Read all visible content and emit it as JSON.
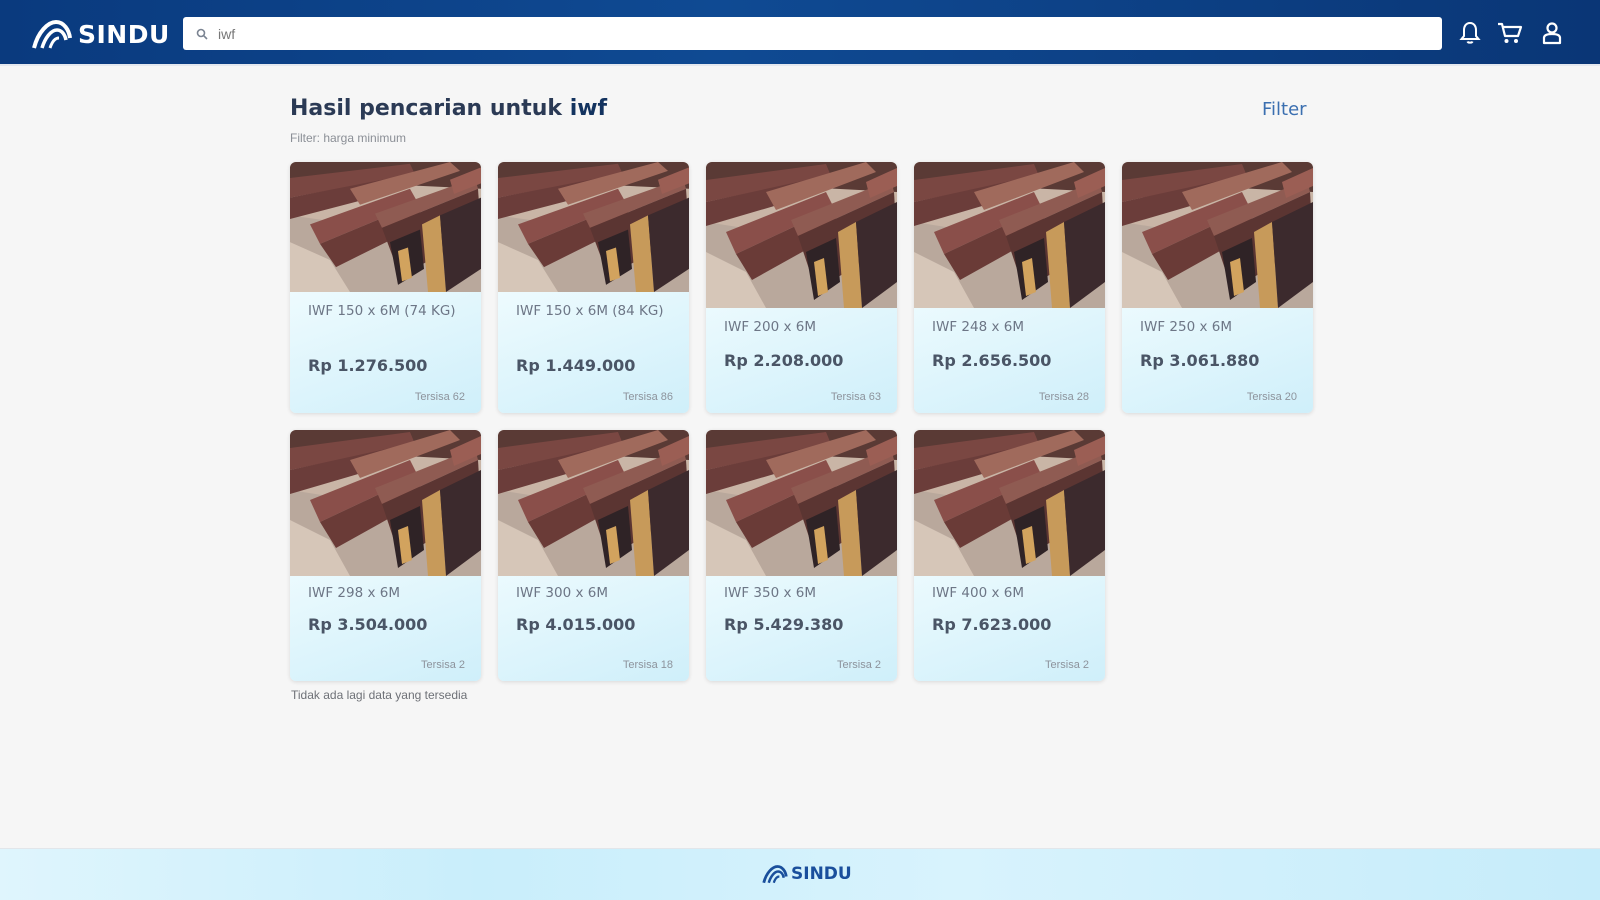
{
  "brand": {
    "name": "SINDU"
  },
  "search": {
    "value": "iwf",
    "icon": "search-icon"
  },
  "nav_icons": [
    "bell-icon",
    "cart-icon",
    "user-icon"
  ],
  "results": {
    "title_prefix": "Hasil pencarian untuk",
    "query": "iwf",
    "filter_label": "Filter",
    "filter_info": "Filter: harga minimum",
    "end_note": "Tidak ada lagi data yang tersedia"
  },
  "products": [
    {
      "name": "IWF 150 x 6M (74 KG)",
      "price": "Rp 1.276.500",
      "stock": "Tersisa 62"
    },
    {
      "name": "IWF 150 x 6M (84 KG)",
      "price": "Rp 1.449.000",
      "stock": "Tersisa 86"
    },
    {
      "name": "IWF 200 x 6M",
      "price": "Rp 2.208.000",
      "stock": "Tersisa 63"
    },
    {
      "name": "IWF 248 x 6M",
      "price": "Rp 2.656.500",
      "stock": "Tersisa 28"
    },
    {
      "name": "IWF 250 x 6M",
      "price": "Rp 3.061.880",
      "stock": "Tersisa 20"
    },
    {
      "name": "IWF 298 x 6M",
      "price": "Rp 3.504.000",
      "stock": "Tersisa 2"
    },
    {
      "name": "IWF 300 x 6M",
      "price": "Rp 4.015.000",
      "stock": "Tersisa 18"
    },
    {
      "name": "IWF 350 x 6M",
      "price": "Rp 5.429.380",
      "stock": "Tersisa 2"
    },
    {
      "name": "IWF 400 x 6M",
      "price": "Rp 7.623.000",
      "stock": "Tersisa 2"
    }
  ],
  "footer": {
    "brand": "SINDU"
  },
  "colors": {
    "navbar": "#0f4a93",
    "accent": "#3b6fb0",
    "footer": "#c9eefb"
  }
}
